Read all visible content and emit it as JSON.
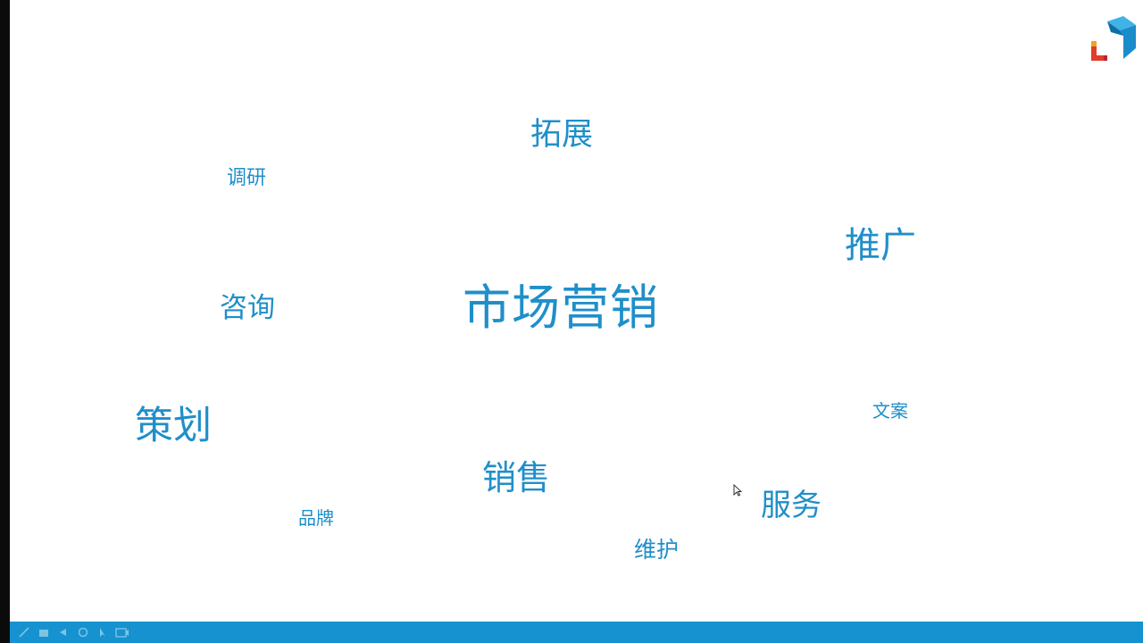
{
  "slide": {
    "center_word": "市场营销",
    "words": {
      "tuozhan": "拓展",
      "diaoyan": "调研",
      "tuiguang": "推广",
      "zixun": "咨询",
      "cehua": "策划",
      "wenan": "文案",
      "xiaoshou": "销售",
      "fuwu": "服务",
      "pinpai": "品牌",
      "weihu": "维护"
    }
  },
  "colors": {
    "word_color": "#1f8fc9",
    "taskbar": "#1592cf",
    "logo_blue": "#1a8ccc",
    "logo_red": "#e23c2b",
    "logo_orange": "#f2a21f"
  },
  "icons": {
    "logo": "brand-logo-icon",
    "cursor": "mouse-pointer-icon",
    "toolbar": [
      "pen-icon",
      "highlighter-icon",
      "arrow-icon",
      "eraser-icon",
      "pointer-icon",
      "camera-icon"
    ]
  }
}
